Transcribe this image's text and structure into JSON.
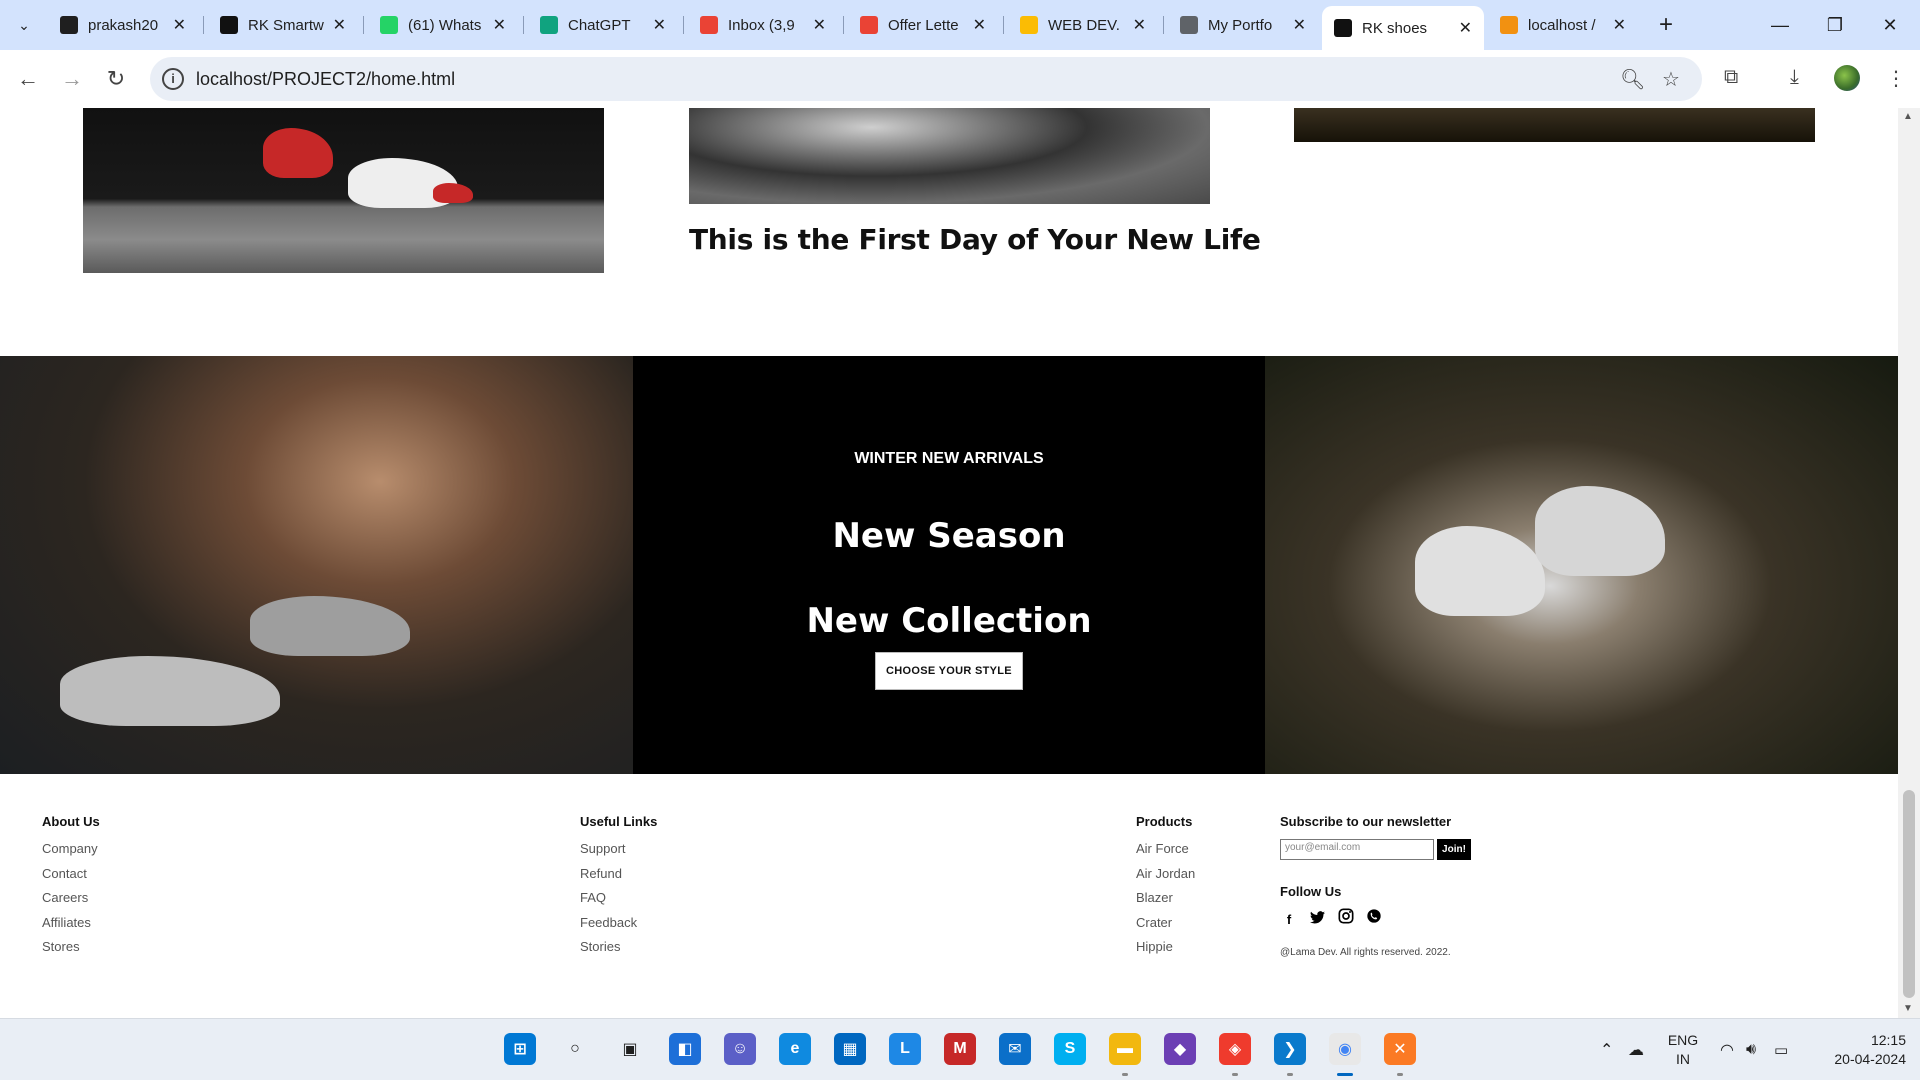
{
  "browser": {
    "tabs": [
      {
        "title": "prakash20",
        "favicon": "github-icon",
        "color": "#1f1f1f"
      },
      {
        "title": "RK Smartw",
        "favicon": "rk-icon",
        "color": "#111111"
      },
      {
        "title": "(61) Whats",
        "favicon": "whatsapp-icon",
        "color": "#25d366"
      },
      {
        "title": "ChatGPT",
        "favicon": "chatgpt-icon",
        "color": "#10a37f"
      },
      {
        "title": "Inbox (3,9",
        "favicon": "gmail-icon",
        "color": "#ea4335"
      },
      {
        "title": "Offer Lette",
        "favicon": "gmail-icon",
        "color": "#ea4335"
      },
      {
        "title": "WEB DEV.",
        "favicon": "drive-icon",
        "color": "#fbbc04"
      },
      {
        "title": "My Portfo",
        "favicon": "globe-icon",
        "color": "#5f6368"
      },
      {
        "title": "RK shoes",
        "favicon": "rk-icon",
        "color": "#111111",
        "active": true
      },
      {
        "title": "localhost /",
        "favicon": "phpmyadmin-icon",
        "color": "#f29111"
      }
    ],
    "url": "localhost/PROJECT2/home.html"
  },
  "page": {
    "blog_title": "This is the First Day of Your New Life",
    "banner": {
      "eyebrow": "WINTER NEW ARRIVALS",
      "heading1": "New Season",
      "heading2": "New Collection",
      "button": "CHOOSE YOUR STYLE"
    },
    "footer": {
      "about": {
        "title": "About Us",
        "links": [
          "Company",
          "Contact",
          "Careers",
          "Affiliates",
          "Stores"
        ]
      },
      "useful": {
        "title": "Useful Links",
        "links": [
          "Support",
          "Refund",
          "FAQ",
          "Feedback",
          "Stories"
        ]
      },
      "products": {
        "title": "Products",
        "links": [
          "Air Force",
          "Air Jordan",
          "Blazer",
          "Crater",
          "Hippie"
        ]
      },
      "newsletter": {
        "title": "Subscribe to our newsletter",
        "placeholder": "your@email.com",
        "button": "Join!"
      },
      "follow": {
        "title": "Follow Us",
        "icons": [
          "facebook-icon",
          "twitter-icon",
          "instagram-icon",
          "whatsapp-icon"
        ]
      },
      "copyright": "@Lama Dev. All rights reserved. 2022."
    }
  },
  "taskbar": {
    "apps": [
      "start-icon",
      "search-icon",
      "task-view-icon",
      "widgets-icon",
      "teams-icon",
      "edge-icon",
      "store-icon",
      "lama-icon",
      "mcafee-icon",
      "mail-icon",
      "skype-icon",
      "file-explorer-icon",
      "visual-studio-icon",
      "anydesk-icon",
      "vscode-icon",
      "chrome-icon",
      "xampp-icon"
    ],
    "language": {
      "line1": "ENG",
      "line2": "IN"
    },
    "time": "12:15",
    "date": "20-04-2024"
  }
}
